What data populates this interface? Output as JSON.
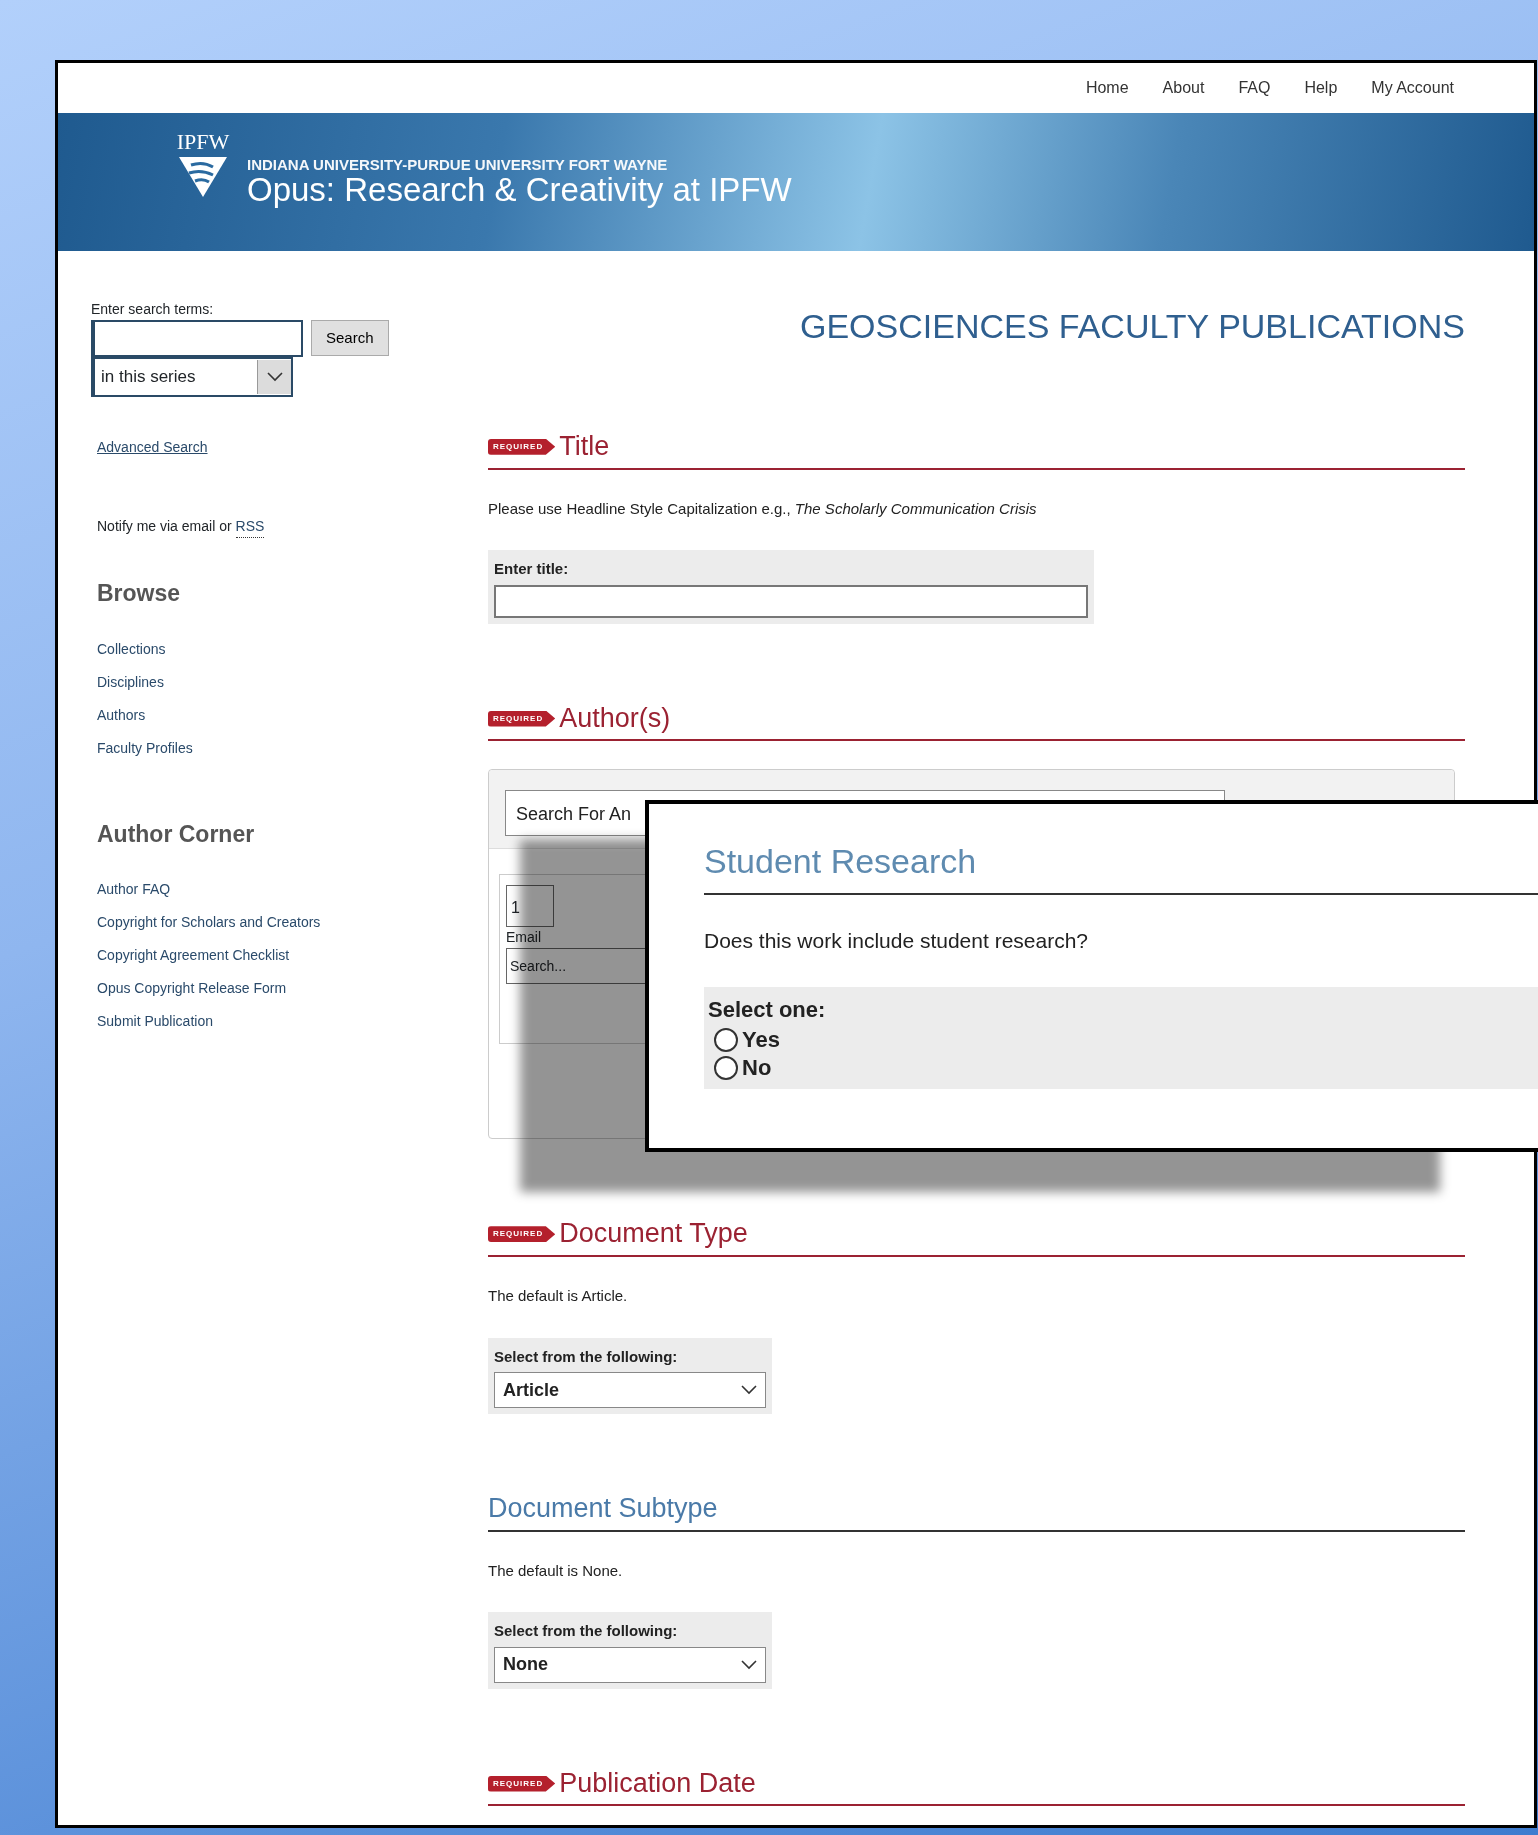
{
  "top_nav": [
    "Home",
    "About",
    "FAQ",
    "Help",
    "My Account"
  ],
  "banner": {
    "logo_text": "IPFW",
    "subtitle": "INDIANA UNIVERSITY-PURDUE UNIVERSITY FORT WAYNE",
    "title": "Opus: Research & Creativity at IPFW"
  },
  "sidebar": {
    "search_label": "Enter search terms:",
    "search_button": "Search",
    "scope": "in this series",
    "advanced_search": "Advanced Search",
    "notify_text": "Notify me via email or",
    "notify_link": "RSS",
    "sections": [
      {
        "heading": "Browse",
        "links": [
          "Collections",
          "Disciplines",
          "Authors",
          "Faculty Profiles"
        ]
      },
      {
        "heading": "Author Corner",
        "links": [
          "Author FAQ",
          "Copyright for Scholars and Creators",
          "Copyright Agreement Checklist",
          "Opus Copyright Release Form",
          "Submit Publication"
        ]
      }
    ]
  },
  "page_title": "GEOSCIENCES FACULTY PUBLICATIONS",
  "form_sections": [
    {
      "kind": "text",
      "required": true,
      "badge": "REQUIRED",
      "heading": "Title",
      "help": "Please use Headline Style Capitalization e.g., *The Scholarly Communication Crisis*",
      "field_label": "Enter title:"
    },
    {
      "kind": "authors",
      "required": true,
      "badge": "REQUIRED",
      "heading": "Author(s)",
      "search_value": "Search For An",
      "row_number": "1",
      "email_label": "Email",
      "email_placeholder": "Search..."
    },
    {
      "kind": "select",
      "required": true,
      "badge": "REQUIRED",
      "heading": "Document Type",
      "help": "The default is Article.",
      "field_label": "Select from the following:",
      "value": "Article"
    },
    {
      "kind": "select",
      "required": false,
      "heading": "Document Subtype",
      "help": "The default is None.",
      "field_label": "Select from the following:",
      "value": "None"
    },
    {
      "kind": "heading",
      "required": true,
      "badge": "REQUIRED",
      "heading": "Publication Date"
    }
  ],
  "dialog": {
    "title": "Student Research",
    "question": "Does this work include student research?",
    "label": "Select one:",
    "options": [
      {
        "label": "Yes",
        "selected": false
      },
      {
        "label": "No",
        "selected": false
      }
    ]
  }
}
